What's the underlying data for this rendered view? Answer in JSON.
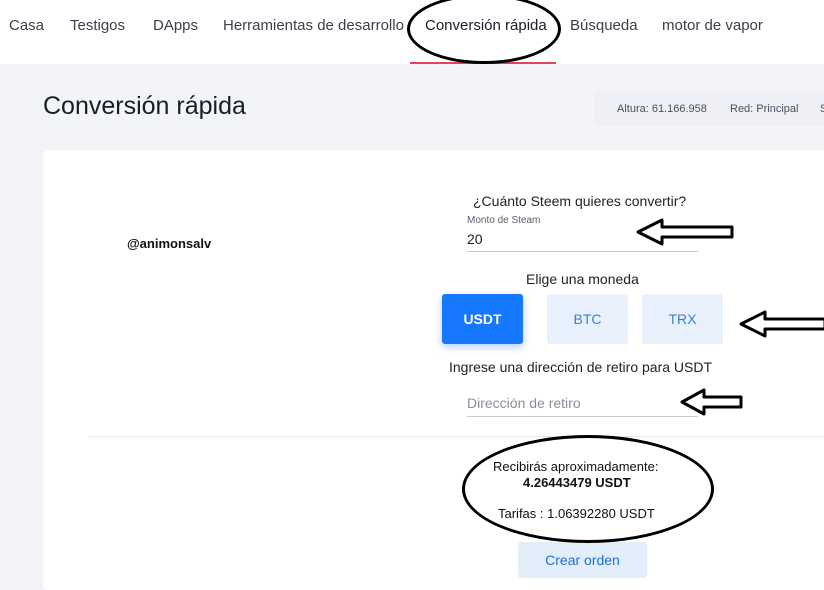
{
  "nav": {
    "items": [
      "Casa",
      "Testigos",
      "DApps",
      "Herramientas de desarrollo",
      "Conversión rápida",
      "Búsqueda",
      "motor de vapor"
    ],
    "active": "Conversión rápida"
  },
  "page": {
    "title": "Conversión rápida"
  },
  "status": {
    "height": "Altura: 61.166.958",
    "network": "Red: Principal",
    "extra": "S"
  },
  "form": {
    "username": "@animonsalv",
    "question": "¿Cuánto Steem quieres convertir?",
    "amount_label": "Monto de Steam",
    "amount_value": "20",
    "choose_coin": "Elige una moneda",
    "coins": [
      "USDT",
      "BTC",
      "TRX"
    ],
    "selected_coin": "USDT",
    "withdraw_label": "Ingrese una dirección de retiro para USDT",
    "withdraw_placeholder": "Dirección de retiro"
  },
  "summary": {
    "receive_label": "Recibirás aproximadamente:",
    "receive_value": "4.26443479 USDT",
    "fees": "Tarifas : 1.06392280 USDT"
  },
  "actions": {
    "create_order": "Crear orden"
  },
  "colors": {
    "primary": "#1677ff",
    "accent_underline": "#e0455c",
    "background": "#f3f4f8"
  }
}
